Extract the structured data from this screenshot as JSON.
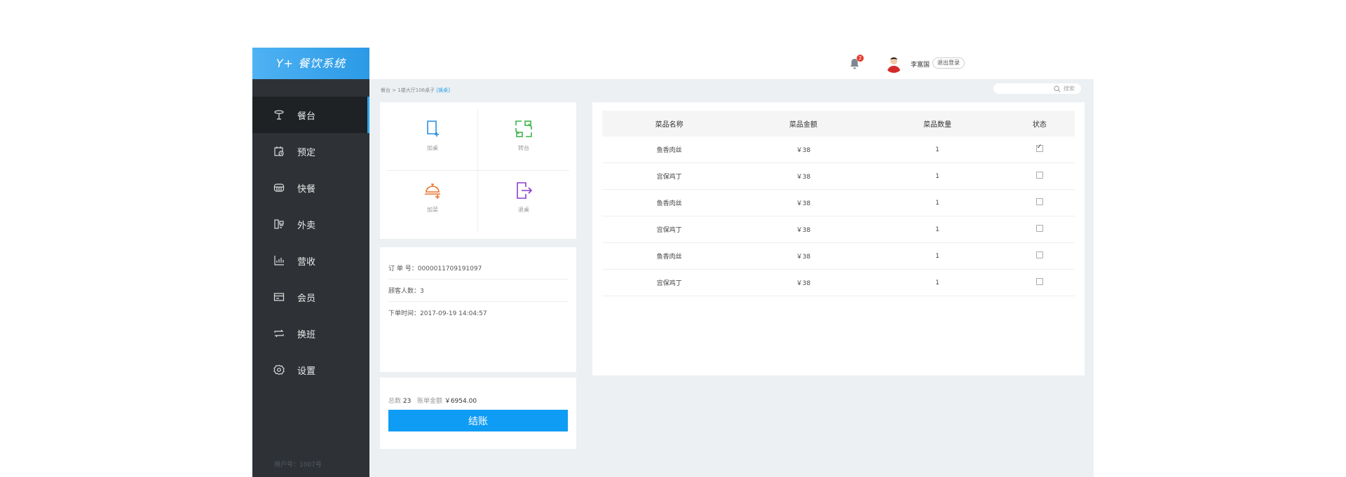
{
  "app": {
    "title": "Y+ 餐饮系统"
  },
  "sidebar": {
    "items": [
      {
        "label": "餐台",
        "icon": "table-icon",
        "active": true
      },
      {
        "label": "预定",
        "icon": "calendar-clock-icon",
        "active": false
      },
      {
        "label": "快餐",
        "icon": "fast-food-icon",
        "active": false
      },
      {
        "label": "外卖",
        "icon": "delivery-icon",
        "active": false
      },
      {
        "label": "营收",
        "icon": "chart-icon",
        "active": false
      },
      {
        "label": "会员",
        "icon": "member-card-icon",
        "active": false
      },
      {
        "label": "换班",
        "icon": "shift-change-icon",
        "active": false
      },
      {
        "label": "设置",
        "icon": "gear-icon",
        "active": false
      }
    ],
    "user_no": "用户号：1007号"
  },
  "header": {
    "notification_count": "2",
    "user_name": "李富国",
    "logout_label": "退出登录"
  },
  "breadcrumb": {
    "path": "餐台 > 1楼大厅106桌子",
    "switch_label": "[换桌]"
  },
  "search": {
    "placeholder": "搜索"
  },
  "actions": [
    {
      "label": "加桌",
      "icon": "add-table-icon",
      "color": "#2a8fe0"
    },
    {
      "label": "转台",
      "icon": "transfer-table-icon",
      "color": "#3cb44a"
    },
    {
      "label": "加菜",
      "icon": "add-dish-icon",
      "color": "#e8742a"
    },
    {
      "label": "退桌",
      "icon": "exit-table-icon",
      "color": "#8a3fd0"
    }
  ],
  "order": {
    "order_no": "订 单 号：0000011709191097",
    "guests": "顾客人数：3",
    "order_time": "下单时间：2017-09-19 14:04:57"
  },
  "totals": {
    "count_label": "总数",
    "count_value": "23",
    "amount_label": "账单金额",
    "amount_value": "￥6954.00",
    "checkout_label": "结账"
  },
  "dish_table": {
    "headers": [
      "菜品名称",
      "菜品金额",
      "菜品数量",
      "状态"
    ],
    "rows": [
      {
        "name": "鱼香肉丝",
        "price": "￥38",
        "qty": "1",
        "checked": true
      },
      {
        "name": "宫保鸡丁",
        "price": "￥38",
        "qty": "1",
        "checked": false
      },
      {
        "name": "鱼香肉丝",
        "price": "￥38",
        "qty": "1",
        "checked": false
      },
      {
        "name": "宫保鸡丁",
        "price": "￥38",
        "qty": "1",
        "checked": false
      },
      {
        "name": "鱼香肉丝",
        "price": "￥38",
        "qty": "1",
        "checked": false
      },
      {
        "name": "宫保鸡丁",
        "price": "￥38",
        "qty": "1",
        "checked": false
      }
    ]
  },
  "colors": {
    "accent": "#0e9cf5",
    "sidebar": "#2e3236",
    "content_bg": "#ecf0f3"
  }
}
